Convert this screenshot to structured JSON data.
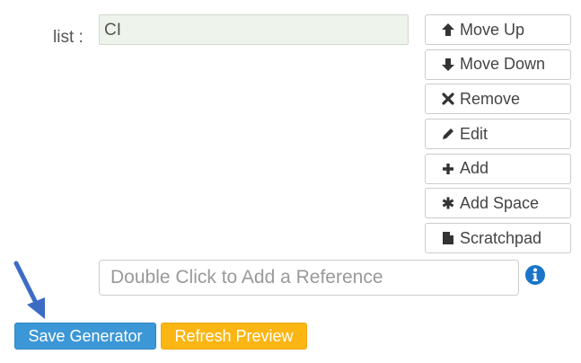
{
  "list": {
    "label": "list :",
    "items": [
      "CI"
    ]
  },
  "side_buttons": [
    {
      "label": "Move Up",
      "icon": "arrow-up-icon"
    },
    {
      "label": "Move Down",
      "icon": "arrow-down-icon"
    },
    {
      "label": "Remove",
      "icon": "x-icon"
    },
    {
      "label": "Edit",
      "icon": "pencil-icon"
    },
    {
      "label": "Add",
      "icon": "plus-icon"
    },
    {
      "label": "Add Space",
      "icon": "asterisk-icon"
    },
    {
      "label": "Scratchpad",
      "icon": "file-icon"
    }
  ],
  "reference": {
    "placeholder": "Double Click to Add a Reference",
    "info_icon": "info-icon"
  },
  "footer": {
    "save_label": "Save Generator",
    "refresh_label": "Refresh Preview"
  },
  "colors": {
    "list_bg": "#eef4ec",
    "save_bg": "#3c97d6",
    "refresh_bg": "#fbb614",
    "info_icon": "#1a75c9",
    "annotation_arrow": "#3d6cc4"
  }
}
